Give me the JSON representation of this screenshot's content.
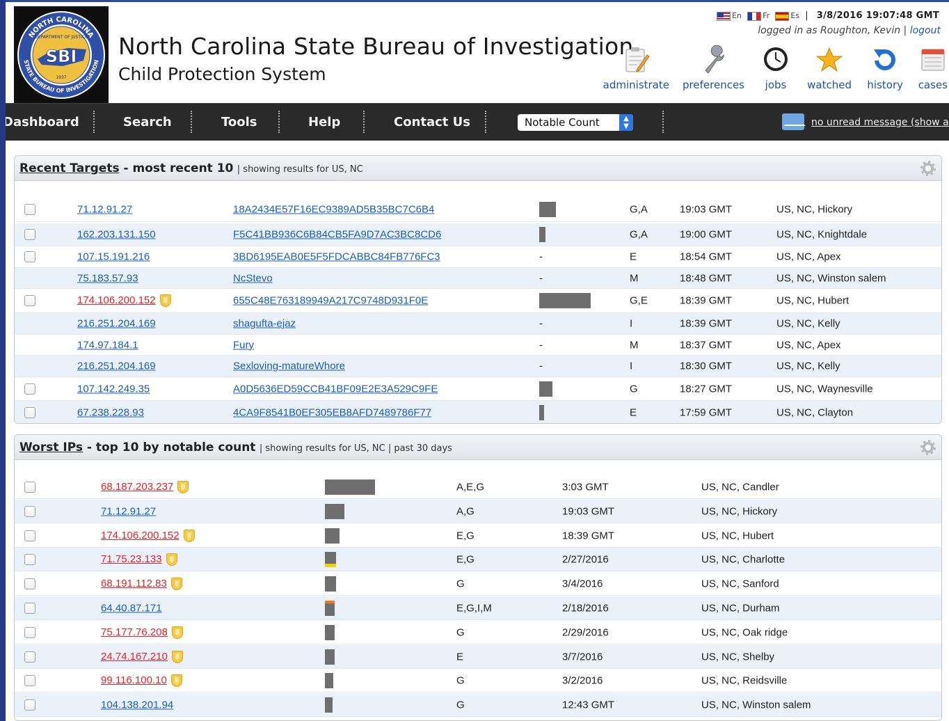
{
  "header": {
    "title": "North Carolina State Bureau of Investigation",
    "subtitle": "Child Protection System",
    "logo": {
      "outer_text": "NORTH CAROLINA",
      "inner_text": "DEPARTMENT OF JUSTICE",
      "emblem": "SBI",
      "year": "1937",
      "bottom_text": "STATE BUREAU OF INVESTIGATION"
    },
    "languages": [
      "En",
      "Fr",
      "Es"
    ],
    "separator": "|",
    "datetime": "3/8/2016 19:07:48 GMT",
    "login_text": "logged in as Roughton, Kevin",
    "login_sep": "|",
    "logout": "logout",
    "toolbar": [
      {
        "label": "administrate",
        "icon": "clipboard-pencil-icon"
      },
      {
        "label": "preferences",
        "icon": "wrench-icon"
      },
      {
        "label": "jobs",
        "icon": "clock-icon"
      },
      {
        "label": "watched",
        "icon": "star-icon"
      },
      {
        "label": "history",
        "icon": "refresh-icon"
      },
      {
        "label": "cases",
        "icon": "folder-icon"
      }
    ]
  },
  "nav": {
    "items": [
      "Dashboard",
      "Search",
      "Tools",
      "Help",
      "Contact Us"
    ],
    "select_value": "Notable Count",
    "messages": "no unread message (show all)"
  },
  "recent_targets": {
    "title_link": "Recent Targets",
    "title_rest": " - most recent 10",
    "subtitle": "| showing results for US, NC",
    "rows": [
      {
        "checkbox": true,
        "ip": "71.12.91.27",
        "red": false,
        "shield": false,
        "target": "18A2434E57F16EC9389AD5B35BC7C6B4",
        "bar": "",
        "level": 0.32,
        "cats": "G,A",
        "time": "19:03 GMT",
        "loc": "US, NC, Hickory"
      },
      {
        "checkbox": true,
        "ip": "162.203.131.150",
        "red": false,
        "shield": false,
        "target": "F5C41BB936C6B84CB5FA9D7AC3BC8CD6",
        "bar": "",
        "level": 0.12,
        "cats": "G,A",
        "time": "19:00 GMT",
        "loc": "US, NC, Knightdale"
      },
      {
        "checkbox": true,
        "ip": "107.15.191.216",
        "red": false,
        "shield": false,
        "target": "3BD6195EAB0E5F5FDCABBC84FB776FC3",
        "bar": "-",
        "level": 0,
        "cats": "E",
        "time": "18:54 GMT",
        "loc": "US, NC, Apex"
      },
      {
        "checkbox": false,
        "ip": "75.183.57.93",
        "red": false,
        "shield": false,
        "target": "NcStevo",
        "bar": "-",
        "level": 0,
        "cats": "M",
        "time": "18:48 GMT",
        "loc": "US, NC, Winston salem"
      },
      {
        "checkbox": true,
        "ip": "174.106.200.152",
        "red": true,
        "shield": true,
        "target": "655C48E763189949A217C9748D931F0E",
        "bar": "",
        "level": 1.0,
        "cats": "G,E",
        "time": "18:39 GMT",
        "loc": "US, NC, Hubert"
      },
      {
        "checkbox": false,
        "ip": "216.251.204.169",
        "red": false,
        "shield": false,
        "target": "shagufta-ejaz",
        "bar": "-",
        "level": 0,
        "cats": "I",
        "time": "18:39 GMT",
        "loc": "US, NC, Kelly"
      },
      {
        "checkbox": false,
        "ip": "174.97.184.1",
        "red": false,
        "shield": false,
        "target": "Fury",
        "bar": "-",
        "level": 0,
        "cats": "M",
        "time": "18:37 GMT",
        "loc": "US, NC, Apex"
      },
      {
        "checkbox": false,
        "ip": "216.251.204.169",
        "red": false,
        "shield": false,
        "target": "Sexloving-matureWhore",
        "bar": "-",
        "level": 0,
        "cats": "I",
        "time": "18:30 GMT",
        "loc": "US, NC, Kelly"
      },
      {
        "checkbox": true,
        "ip": "107.142.249.35",
        "red": false,
        "shield": false,
        "target": "A0D5636ED59CCB41BF09E2E3A529C9FE",
        "bar": "",
        "level": 0.26,
        "cats": "G",
        "time": "18:27 GMT",
        "loc": "US, NC, Waynesville"
      },
      {
        "checkbox": true,
        "ip": "67.238.228.93",
        "red": false,
        "shield": false,
        "target": "4CA9F8541B0EF305EB8AFD7489786F77",
        "bar": "",
        "level": 0.1,
        "cats": "E",
        "time": "17:59 GMT",
        "loc": "US, NC, Clayton"
      }
    ]
  },
  "worst_ips": {
    "title_link": "Worst IPs",
    "title_rest": " - top 10 by notable count",
    "subtitle": "| showing results for US, NC | past 30 days",
    "rows": [
      {
        "ip": "68.187.203.237",
        "red": true,
        "shield": true,
        "level": 1.0,
        "accent": "",
        "cats": "A,E,G",
        "time": "3:03 GMT",
        "loc": "US, NC, Candler"
      },
      {
        "ip": "71.12.91.27",
        "red": false,
        "shield": false,
        "level": 0.39,
        "accent": "",
        "cats": "A,G",
        "time": "19:03 GMT",
        "loc": "US, NC, Hickory"
      },
      {
        "ip": "174.106.200.152",
        "red": true,
        "shield": true,
        "level": 0.29,
        "accent": "",
        "cats": "E,G",
        "time": "18:39 GMT",
        "loc": "US, NC, Hubert"
      },
      {
        "ip": "71.75.23.133",
        "red": true,
        "shield": true,
        "level": 0.22,
        "accent": "#f2d400",
        "cats": "E,G",
        "time": "2/27/2016",
        "loc": "US, NC, Charlotte"
      },
      {
        "ip": "68.191.112.83",
        "red": true,
        "shield": true,
        "level": 0.22,
        "accent": "",
        "cats": "G",
        "time": "3/4/2016",
        "loc": "US, NC, Sanford"
      },
      {
        "ip": "64.40.87.171",
        "red": false,
        "shield": false,
        "level": 0.19,
        "accent": "#ef7d1a",
        "cats": "E,G,I,M",
        "time": "2/18/2016",
        "loc": "US, NC, Durham"
      },
      {
        "ip": "75.177.76.208",
        "red": true,
        "shield": true,
        "level": 0.19,
        "accent": "",
        "cats": "G",
        "time": "2/29/2016",
        "loc": "US, NC, Oak ridge"
      },
      {
        "ip": "24.74.167.210",
        "red": true,
        "shield": true,
        "level": 0.19,
        "accent": "",
        "cats": "E",
        "time": "3/7/2016",
        "loc": "US, NC, Shelby"
      },
      {
        "ip": "99.116.100.10",
        "red": true,
        "shield": true,
        "level": 0.17,
        "accent": "",
        "cats": "G",
        "time": "3/2/2016",
        "loc": "US, NC, Reidsville"
      },
      {
        "ip": "104.138.201.94",
        "red": false,
        "shield": false,
        "level": 0.15,
        "accent": "",
        "cats": "G",
        "time": "12:43 GMT",
        "loc": "US, NC, Winston salem"
      }
    ]
  },
  "colors": {
    "link": "#1a5fbf",
    "alert": "#e8232a",
    "nav_bg": "#2a2a2a",
    "row_alt": "#eaf1fa",
    "frame": "#233a86"
  }
}
